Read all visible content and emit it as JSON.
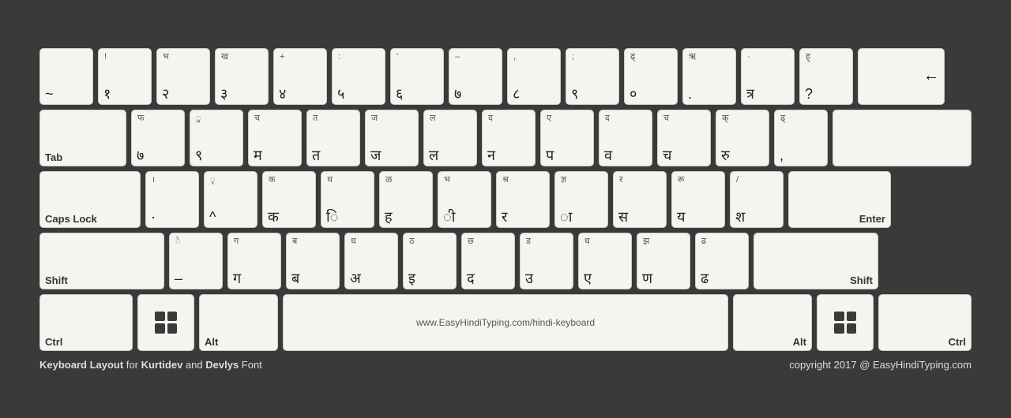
{
  "keyboard": {
    "rows": [
      {
        "keys": [
          {
            "top": "",
            "bottom": "~",
            "label": "",
            "classes": ""
          },
          {
            "top": "!",
            "bottom": "१",
            "label": "",
            "classes": ""
          },
          {
            "top": "भ",
            "bottom": "२",
            "label": "",
            "classes": ""
          },
          {
            "top": "ख",
            "bottom": "३",
            "label": "",
            "classes": ""
          },
          {
            "top": "+",
            "bottom": "४",
            "label": "",
            "classes": ""
          },
          {
            "top": ":",
            "bottom": "५",
            "label": "",
            "classes": ""
          },
          {
            "top": "'",
            "bottom": "६",
            "label": "",
            "classes": ""
          },
          {
            "top": "–",
            "bottom": "७",
            "label": "",
            "classes": ""
          },
          {
            "top": ",",
            "bottom": "८",
            "label": "",
            "classes": ""
          },
          {
            "top": ";",
            "bottom": "९",
            "label": "",
            "classes": ""
          },
          {
            "top": "ढ्",
            "bottom": "०",
            "label": "",
            "classes": ""
          },
          {
            "top": "ऋ",
            "bottom": ".",
            "label": "",
            "classes": ""
          },
          {
            "top": "·",
            "bottom": "त्र",
            "label": "",
            "classes": ""
          },
          {
            "top": "ह्",
            "bottom": "?",
            "label": "",
            "classes": ""
          },
          {
            "top": "",
            "bottom": "←",
            "label": "",
            "classes": "wide-backspace backspace-key"
          }
        ]
      },
      {
        "keys": [
          {
            "top": "",
            "bottom": "",
            "label": "Tab",
            "classes": "wide-tab"
          },
          {
            "top": "फ",
            "bottom": "७",
            "label": "",
            "classes": ""
          },
          {
            "top": "ु",
            "bottom": "९",
            "label": "",
            "classes": ""
          },
          {
            "top": "च",
            "bottom": "म",
            "label": "",
            "classes": ""
          },
          {
            "top": "त",
            "bottom": "त",
            "label": "",
            "classes": ""
          },
          {
            "top": "ज",
            "bottom": "ज",
            "label": "",
            "classes": ""
          },
          {
            "top": "ल",
            "bottom": "ल",
            "label": "",
            "classes": ""
          },
          {
            "top": "द",
            "bottom": "न",
            "label": "",
            "classes": ""
          },
          {
            "top": "ए",
            "bottom": "प",
            "label": "",
            "classes": ""
          },
          {
            "top": "द",
            "bottom": "व",
            "label": "",
            "classes": ""
          },
          {
            "top": "च",
            "bottom": "च",
            "label": "",
            "classes": ""
          },
          {
            "top": "क्",
            "bottom": "रु",
            "label": "",
            "classes": ""
          },
          {
            "top": "ढ्",
            "bottom": ",",
            "label": "",
            "classes": ""
          },
          {
            "top": "",
            "bottom": "",
            "label": "",
            "classes": "wide-enter"
          }
        ]
      },
      {
        "keys": [
          {
            "top": "",
            "bottom": "",
            "label": "Caps Lock",
            "classes": "wide-caps"
          },
          {
            "top": "।",
            "bottom": "·",
            "label": "",
            "classes": ""
          },
          {
            "top": "ृ",
            "bottom": "^",
            "label": "",
            "classes": ""
          },
          {
            "top": "क",
            "bottom": "क",
            "label": "",
            "classes": ""
          },
          {
            "top": "थ",
            "bottom": "ि",
            "label": "",
            "classes": ""
          },
          {
            "top": "ळ",
            "bottom": "ह",
            "label": "",
            "classes": ""
          },
          {
            "top": "भ",
            "bottom": "ी",
            "label": "",
            "classes": ""
          },
          {
            "top": "श्र",
            "bottom": "र",
            "label": "",
            "classes": ""
          },
          {
            "top": "ज्ञ",
            "bottom": "ा",
            "label": "",
            "classes": ""
          },
          {
            "top": "र",
            "bottom": "स",
            "label": "",
            "classes": ""
          },
          {
            "top": "रू",
            "bottom": "य",
            "label": "",
            "classes": ""
          },
          {
            "top": "/",
            "bottom": "श",
            "label": "",
            "classes": ""
          },
          {
            "top": "",
            "bottom": "",
            "label": "Enter",
            "classes": "wide-enter"
          }
        ]
      },
      {
        "keys": [
          {
            "top": "",
            "bottom": "",
            "label": "Shift",
            "classes": "wide-shift-l"
          },
          {
            "top": "े",
            "bottom": "–",
            "label": "",
            "classes": ""
          },
          {
            "top": "ग",
            "bottom": "ग",
            "label": "",
            "classes": ""
          },
          {
            "top": "ब",
            "bottom": "ब",
            "label": "",
            "classes": ""
          },
          {
            "top": "ध",
            "bottom": "अ",
            "label": "",
            "classes": ""
          },
          {
            "top": "ठ",
            "bottom": "इ",
            "label": "",
            "classes": ""
          },
          {
            "top": "छ",
            "bottom": "द",
            "label": "",
            "classes": ""
          },
          {
            "top": "ड",
            "bottom": "उ",
            "label": "",
            "classes": ""
          },
          {
            "top": "ध",
            "bottom": "ए",
            "label": "",
            "classes": ""
          },
          {
            "top": "झ",
            "bottom": "ण",
            "label": "",
            "classes": ""
          },
          {
            "top": "ढ",
            "bottom": "ढ",
            "label": "",
            "classes": ""
          },
          {
            "top": "",
            "bottom": "",
            "label": "Shift",
            "classes": "wide-shift-r"
          }
        ]
      },
      {
        "keys": [
          {
            "top": "",
            "bottom": "",
            "label": "Ctrl",
            "classes": "wide-ctrl"
          },
          {
            "top": "",
            "bottom": "",
            "label": "WIN",
            "classes": "win-key"
          },
          {
            "top": "",
            "bottom": "",
            "label": "Alt",
            "classes": "wide-alt"
          },
          {
            "top": "",
            "bottom": "www.EasyHindiTyping.com/hindi-keyboard",
            "label": "",
            "classes": "wide-space"
          },
          {
            "top": "",
            "bottom": "",
            "label": "Alt",
            "classes": "wide-alt-r"
          },
          {
            "top": "",
            "bottom": "",
            "label": "WIN",
            "classes": "win-key"
          },
          {
            "top": "",
            "bottom": "",
            "label": "Ctrl",
            "classes": "wide-ctrl-r"
          }
        ]
      }
    ],
    "footer": {
      "left": "Keyboard Layout for Kurtidev and Devlys Font",
      "right": "copyright 2017 @ EasyHindiTyping.com"
    }
  }
}
